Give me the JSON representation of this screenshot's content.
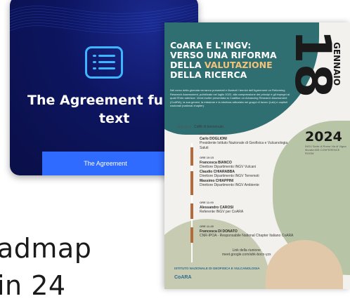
{
  "slide": {
    "line1": "admap",
    "line2": "in 24"
  },
  "card": {
    "title_line1": "The Agreement fu",
    "title_line2": "text",
    "cta_label": "The Agreement",
    "icon": "list-document-icon",
    "colors": {
      "background": "#0d1560",
      "accent": "#3fb5ff",
      "button": "#2f6bff"
    }
  },
  "poster": {
    "head_l1": "CoARA E L'INGV:",
    "head_l2": "VERSO UNA RIFORMA",
    "head_l3a": "DELLA ",
    "head_l3b": "VALUTAZIONE",
    "head_l4": "DELLA RICERCA",
    "body": "Nel corso della giornata verranno presentati e illustrati i termini dell'Agreement on Reforming Research Assessment, pubblicato nel luglio 2022, alla comprensione dei principi e gli impegni ai quali l'Ente aderisce. Verrà inoltre presentata la Coalition on Advancing Research Assessment (CoARA), la sua genesi, la missione e la struttura articolata nei gruppi di lavoro (Lab) e capitoli nazionali (national chapter).",
    "date_num": "18",
    "month": "GENNAIO",
    "year": "2024",
    "venue": "INGV Sede di Roma Via di Vigna Murata 605 CONFERENCE ROOM",
    "coffee_time": "ORE 09:30",
    "coffee_label": "Caffè di benvenuto",
    "entries": [
      {
        "time": "ORE 10:00",
        "name": "Carlo DOGLIONI",
        "role": "Presidente Istituto Nazionale di Geofisica e Vulcanologia",
        "extra": "Saluti"
      },
      {
        "time": "ORE 10:15",
        "name": "Francesca BIANCO",
        "role": "Direttore Dipartimento INGV Vulcani"
      },
      {
        "time": "",
        "name": "Claudio CHIARABBA",
        "role": "Direttore Dipartimento INGV Terremoti"
      },
      {
        "time": "",
        "name": "Massimo CHIAPPINI",
        "role": "Direttore Dipartimento INGV Ambiente"
      },
      {
        "time": "ORE 11:00",
        "name": "Alessandro CAROSI",
        "role": "Referente INGV per CoARA"
      },
      {
        "time": "ORE 11:45",
        "name": "Francesca DI DONATO",
        "role": "CNR-IPOA - Responsabile National Chapter Italiano CoARA"
      }
    ],
    "links_title": "Link della riunione",
    "links_url": "meet.google.com/ahk-bocn-yzs",
    "logo1": "ISTITUTO NAZIONALE DI GEOFISICA E VULCANOLOGIA",
    "logo2": "CoARA",
    "dots": "• • • • •"
  }
}
